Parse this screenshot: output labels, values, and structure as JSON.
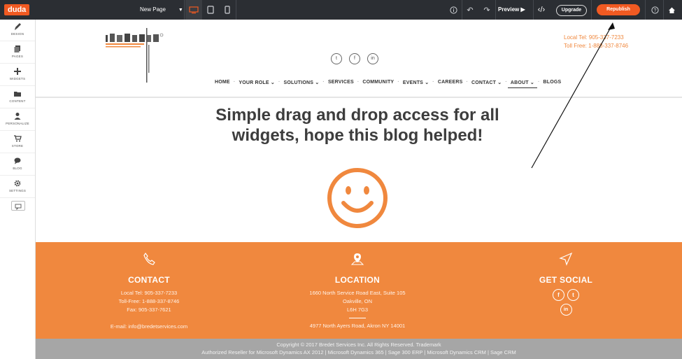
{
  "toolbar": {
    "logo": "duda",
    "page_selector": "New Page",
    "preview_label": "Preview",
    "upgrade_label": "Upgrade",
    "republish_label": "Republish"
  },
  "sidebar": {
    "items": [
      {
        "label": "DESIGN",
        "icon": "brush-icon"
      },
      {
        "label": "PAGES",
        "icon": "pages-icon"
      },
      {
        "label": "WIDGETS",
        "icon": "plus-icon"
      },
      {
        "label": "CONTENT",
        "icon": "folder-icon"
      },
      {
        "label": "PERSONALIZE",
        "icon": "person-icon"
      },
      {
        "label": "STORE",
        "icon": "cart-icon"
      },
      {
        "label": "BLOG",
        "icon": "chat-icon"
      },
      {
        "label": "SETTINGS",
        "icon": "gear-icon"
      }
    ]
  },
  "header": {
    "tel": "Local Tel: 905-337-7233",
    "tollfree": "Toll Free: 1-888-337-8746",
    "nav": [
      "HOME",
      "YOUR ROLE",
      "SOLUTIONS",
      "SERVICES",
      "COMMUNITY",
      "EVENTS",
      "CAREERS",
      "CONTACT",
      "ABOUT",
      "BLOGS"
    ]
  },
  "main": {
    "headline_line1": "Simple drag and drop access for all",
    "headline_line2": "widgets, hope this blog helped!"
  },
  "footer": {
    "contact": {
      "title": "CONTACT",
      "tel": "Local Tel: 905-337-7233",
      "tollfree": "Toll-Free: 1-888-337-8746",
      "fax": "Fax: 905-337-7621",
      "email": "E-mail: info@bredetservices.com"
    },
    "location": {
      "title": "LOCATION",
      "line1": "1660 North Service Road East, Suite 105",
      "line2": "Oakville, ON",
      "line3": "L6H 7G3",
      "line4": "4977 North Ayers Road, Akron NY 14001"
    },
    "social": {
      "title": "GET SOCIAL"
    },
    "copyright_line1": "Copyright © 2017 Bredet Services Inc. All Rights Reserved. Trademark",
    "copyright_line2": "Authorized Reseller for Microsoft Dynamics AX 2012 | Microsoft Dynamics 365 | Sage 300 ERP | Microsoft Dynamics CRM | Sage CRM"
  },
  "colors": {
    "accent": "#f15a22",
    "footer_orange": "#f0883e",
    "topbar": "#2b2e33"
  }
}
